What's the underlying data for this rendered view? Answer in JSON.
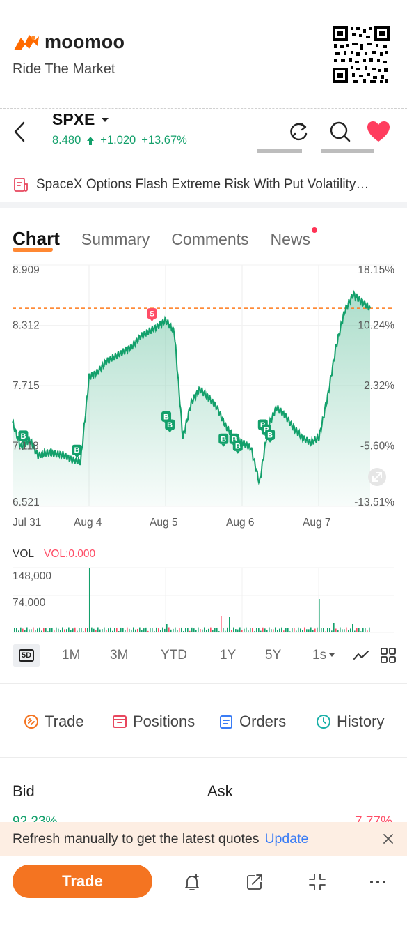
{
  "brand": {
    "name": "moomoo",
    "tagline": "Ride The Market",
    "accent": "#ff6a00"
  },
  "stock": {
    "ticker": "SPXE",
    "price": "8.480",
    "change": "+1.020",
    "change_pct": "+13.67%",
    "up_color": "#13a06b",
    "down_color": "#ff4d66"
  },
  "news_banner": "SpaceX Options Flash Extreme Risk With Put Volatility…",
  "tabs": [
    {
      "label": "Chart",
      "active": true
    },
    {
      "label": "Summary"
    },
    {
      "label": "Comments"
    },
    {
      "label": "News",
      "has_dot": true
    }
  ],
  "chart_data": {
    "type": "line",
    "x": [
      "Jul 31",
      "Aug 4",
      "Aug 5",
      "Aug 6",
      "Aug 7"
    ],
    "y_left_ticks": [
      "8.909",
      "8.312",
      "7.715",
      "7.118",
      "6.521"
    ],
    "y_right_ticks": [
      "18.15%",
      "10.24%",
      "2.32%",
      "-5.60%",
      "-13.51%"
    ],
    "ylim": [
      6.521,
      8.909
    ],
    "prev_close_ref": 8.48,
    "series": [
      {
        "values": [
          7.35,
          7.1,
          7.18,
          7.02,
          7.05,
          7.04,
          7.03,
          6.98,
          6.96,
          7.8,
          7.85,
          7.95,
          8.0,
          8.05,
          8.1,
          8.2,
          8.25,
          8.3,
          8.36,
          8.25,
          7.2,
          7.55,
          7.68,
          7.6,
          7.5,
          7.32,
          7.2,
          7.15,
          7.1,
          6.75,
          7.3,
          7.5,
          7.42,
          7.3,
          7.2,
          7.15,
          7.2,
          7.6,
          8.1,
          8.45,
          8.62,
          8.55,
          8.48
        ]
      }
    ],
    "markers": [
      {
        "type": "B",
        "at": 0.03,
        "value": 7.16
      },
      {
        "type": "B",
        "at": 0.18,
        "value": 7.02
      },
      {
        "type": "S",
        "at": 0.39,
        "value": 8.37
      },
      {
        "type": "B",
        "at": 0.43,
        "value": 7.35
      },
      {
        "type": "B",
        "at": 0.44,
        "value": 7.27
      },
      {
        "type": "B",
        "at": 0.59,
        "value": 7.13
      },
      {
        "type": "B",
        "at": 0.62,
        "value": 7.13
      },
      {
        "type": "B",
        "at": 0.63,
        "value": 7.06
      },
      {
        "type": "B",
        "at": 0.7,
        "value": 7.27
      },
      {
        "type": "B",
        "at": 0.71,
        "value": 7.22
      },
      {
        "type": "B",
        "at": 0.72,
        "value": 7.17
      }
    ]
  },
  "volume": {
    "title": "VOL",
    "value_label": "VOL:0.000",
    "ticks": [
      "148,000",
      "74,000"
    ]
  },
  "ranges": {
    "active": "5D",
    "items": [
      "1M",
      "3M",
      "YTD",
      "1Y",
      "5Y",
      "1s"
    ]
  },
  "actions": {
    "trade": "Trade",
    "positions": "Positions",
    "orders": "Orders",
    "history": "History"
  },
  "order_book": {
    "bid": "Bid",
    "ask": "Ask",
    "bid_pct": "92.23%",
    "ask_pct": "7.77%"
  },
  "refresh": {
    "text": "Refresh manually to get the latest quotes",
    "link": "Update"
  },
  "bottom": {
    "trade_button": "Trade"
  }
}
